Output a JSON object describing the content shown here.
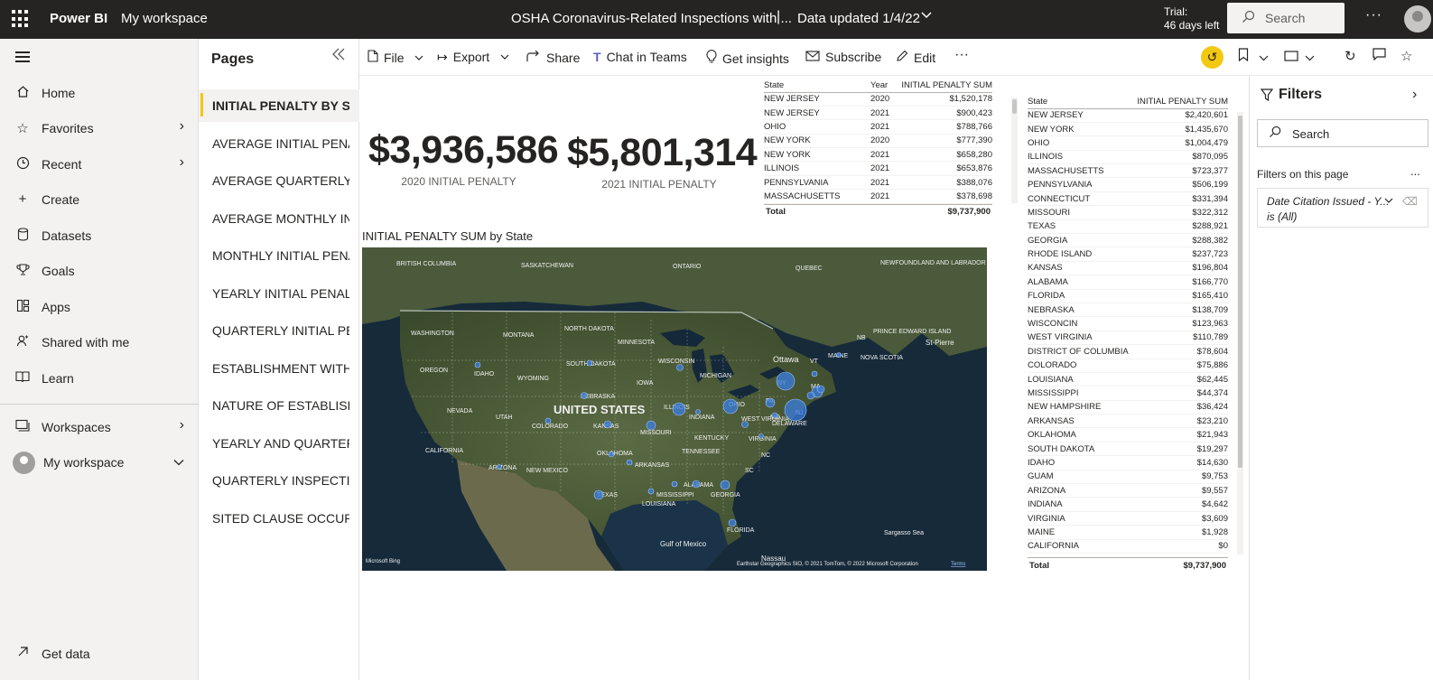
{
  "topbar": {
    "brand": "Power BI",
    "workspace": "My workspace",
    "report_title": "OSHA Coronavirus-Related Inspections with ...",
    "separator": "|",
    "data_updated": "Data updated 1/4/22",
    "trial_line1": "Trial:",
    "trial_line2": "46 days left",
    "search_placeholder": "Search",
    "more": "···"
  },
  "leftnav": {
    "items": [
      {
        "label": "Home",
        "icon": "home-icon"
      },
      {
        "label": "Favorites",
        "icon": "star-icon"
      },
      {
        "label": "Recent",
        "icon": "clock-icon"
      },
      {
        "label": "Create",
        "icon": "plus-icon"
      },
      {
        "label": "Datasets",
        "icon": "database-icon"
      },
      {
        "label": "Goals",
        "icon": "trophy-icon"
      },
      {
        "label": "Apps",
        "icon": "apps-icon"
      },
      {
        "label": "Shared with me",
        "icon": "shared-icon"
      },
      {
        "label": "Learn",
        "icon": "book-icon"
      }
    ],
    "workspaces": "Workspaces",
    "my_workspace": "My workspace",
    "get_data": "Get data"
  },
  "pages": {
    "title": "Pages",
    "items": [
      "INITIAL PENALTY BY STATE",
      "AVERAGE INITIAL PENALTY",
      "AVERAGE QUARTERLY INITIAL PENALTY",
      "AVERAGE MONTHLY INITIAL PENALTY",
      "MONTHLY INITIAL PENALTY",
      "YEARLY INITIAL PENALTY",
      "QUARTERLY INITIAL PENALTY",
      "ESTABLISHMENT WITH PENALTY",
      "NATURE OF ESTABLISHMENT",
      "YEARLY AND QUARTERLY INSPECTIONS",
      "QUARTERLY INSPECTIONS",
      "SITED CLAUSE OCCURRENCES"
    ]
  },
  "toolbar": {
    "file": "File",
    "export": "Export",
    "share": "Share",
    "chat": "Chat in Teams",
    "insights": "Get insights",
    "subscribe": "Subscribe",
    "edit": "Edit",
    "more": "···"
  },
  "kpis": [
    {
      "value": "$3,936,586",
      "caption": "2020 INITIAL PENALTY"
    },
    {
      "value": "$5,801,314",
      "caption": "2021 INITIAL PENALTY"
    }
  ],
  "map": {
    "title": "INITIAL PENALTY SUM by State",
    "country_label": "UNITED STATES",
    "attribution": "Earthstar Geographics SIO, © 2021 TomTom, © 2022 Microsoft Corporation",
    "terms": "Terms",
    "bing": "Microsoft Bing",
    "labels": [
      "BRITISH COLUMBIA",
      "SASKATCHEWAN",
      "ONTARIO",
      "QUEBEC",
      "NEWFOUNDLAND AND LABRADOR",
      "WASHINGTON",
      "MONTANA",
      "NORTH DAKOTA",
      "MINNESOTA",
      "OREGON",
      "IDAHO",
      "WYOMING",
      "SOUTH DAKOTA",
      "WISCONSIN",
      "MICHIGAN",
      "Ottawa",
      "PRINCE EDWARD ISLAND",
      "NB",
      "St-Pierre",
      "NOVA SCOTIA",
      "NEBRASKA",
      "IOWA",
      "ILLINOIS",
      "INDIANA",
      "NEVADA",
      "UTAH",
      "COLORADO",
      "KANSAS",
      "MISSOURI",
      "KENTUCKY",
      "WEST VIRGINIA",
      "VIRGINIA",
      "DELAWARE",
      "CALIFORNIA",
      "OKLAHOMA",
      "TENNESSEE",
      "NC",
      "ARIZONA",
      "NEW MEXICO",
      "ARKANSAS",
      "SC",
      "ALABAMA",
      "MISSISSIPPI",
      "GEORGIA",
      "TEXAS",
      "LOUISIANA",
      "FLORIDA",
      "Gulf of Mexico",
      "Sargasso Sea",
      "Nassau",
      "MAINE",
      "VT",
      "NY",
      "NJ",
      "MA",
      "MD",
      "PA",
      "OHIO"
    ]
  },
  "table_year": {
    "headers": [
      "State",
      "Year",
      "INITIAL PENALTY SUM"
    ],
    "rows": [
      [
        "NEW JERSEY",
        "2020",
        "$1,520,178"
      ],
      [
        "NEW JERSEY",
        "2021",
        "$900,423"
      ],
      [
        "OHIO",
        "2021",
        "$788,766"
      ],
      [
        "NEW YORK",
        "2020",
        "$777,390"
      ],
      [
        "NEW YORK",
        "2021",
        "$658,280"
      ],
      [
        "ILLINOIS",
        "2021",
        "$653,876"
      ],
      [
        "PENNSYLVANIA",
        "2021",
        "$388,076"
      ],
      [
        "MASSACHUSETTS",
        "2021",
        "$378,698"
      ]
    ],
    "total_label": "Total",
    "total_value": "$9,737,900"
  },
  "table_state": {
    "headers": [
      "State",
      "INITIAL PENALTY SUM"
    ],
    "rows": [
      [
        "NEW JERSEY",
        "$2,420,601"
      ],
      [
        "NEW YORK",
        "$1,435,670"
      ],
      [
        "OHIO",
        "$1,004,479"
      ],
      [
        "ILLINOIS",
        "$870,095"
      ],
      [
        "MASSACHUSETTS",
        "$723,377"
      ],
      [
        "PENNSYLVANIA",
        "$506,199"
      ],
      [
        "CONNECTICUT",
        "$331,394"
      ],
      [
        "MISSOURI",
        "$322,312"
      ],
      [
        "TEXAS",
        "$288,921"
      ],
      [
        "GEORGIA",
        "$288,382"
      ],
      [
        "RHODE ISLAND",
        "$237,723"
      ],
      [
        "KANSAS",
        "$196,804"
      ],
      [
        "ALABAMA",
        "$166,770"
      ],
      [
        "FLORIDA",
        "$165,410"
      ],
      [
        "NEBRASKA",
        "$138,709"
      ],
      [
        "WISCONCIN",
        "$123,963"
      ],
      [
        "WEST VIRGINIA",
        "$110,789"
      ],
      [
        "DISTRICT OF COLUMBIA",
        "$78,604"
      ],
      [
        "COLORADO",
        "$75,886"
      ],
      [
        "LOUISIANA",
        "$62,445"
      ],
      [
        "MISSISSIPPI",
        "$44,374"
      ],
      [
        "NEW HAMPSHIRE",
        "$36,424"
      ],
      [
        "ARKANSAS",
        "$23,210"
      ],
      [
        "OKLAHOMA",
        "$21,943"
      ],
      [
        "SOUTH DAKOTA",
        "$19,297"
      ],
      [
        "IDAHO",
        "$14,630"
      ],
      [
        "GUAM",
        "$9,753"
      ],
      [
        "ARIZONA",
        "$9,557"
      ],
      [
        "INDIANA",
        "$4,642"
      ],
      [
        "VIRGINIA",
        "$3,609"
      ],
      [
        "MAINE",
        "$1,928"
      ],
      [
        "CALIFORNIA",
        "$0"
      ]
    ],
    "total_label": "Total",
    "total_value": "$9,737,900"
  },
  "filters": {
    "title": "Filters",
    "search_placeholder": "Search",
    "subtitle": "Filters on this page",
    "card_line1": "Date Citation Issued - Y...",
    "card_line2": "is (All)",
    "more": "..."
  },
  "colors": {
    "topbar": "#252423",
    "accent_yellow": "#f2c811",
    "bubble": "#3a7ee0"
  }
}
